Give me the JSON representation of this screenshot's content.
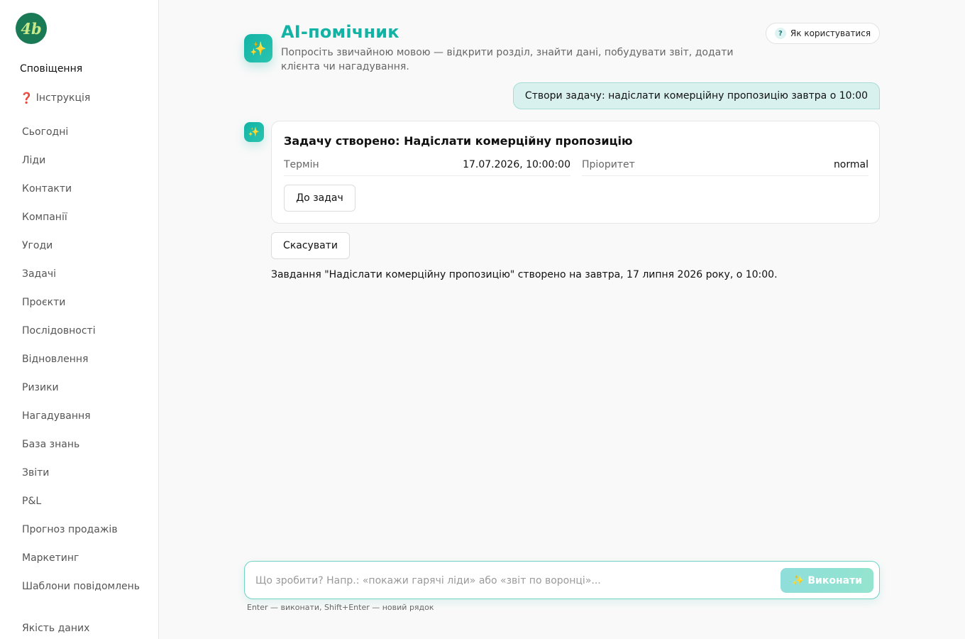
{
  "sidebar": {
    "logo_text": "4b",
    "notifications": "Сповіщення",
    "help_icon": "❓",
    "help_label": "Інструкція",
    "items": [
      {
        "label": "Сьогодні"
      },
      {
        "label": "Ліди"
      },
      {
        "label": "Контакти"
      },
      {
        "label": "Компанії"
      },
      {
        "label": "Угоди"
      },
      {
        "label": "Задачі"
      },
      {
        "label": "Проєкти"
      },
      {
        "label": "Послідовності"
      },
      {
        "label": "Відновлення"
      },
      {
        "label": "Ризики"
      },
      {
        "label": "Нагадування"
      },
      {
        "label": "База знань"
      },
      {
        "label": "Звіти"
      },
      {
        "label": "P&L"
      },
      {
        "label": "Прогноз продажів"
      },
      {
        "label": "Маркетинг"
      },
      {
        "label": "Шаблони повідомлень"
      },
      {
        "label": "Якість даних"
      }
    ]
  },
  "header": {
    "icon": "✨",
    "title": "AI-помічник",
    "subtitle": "Попросіть звичайною мовою — відкрити розділ, знайти дані, побудувати звіт, додати клієнта чи нагадування.",
    "help_button_icon": "?",
    "help_button_label": "Як користуватися"
  },
  "chat": {
    "user_message": "Створи задачу: надіслати комерційну пропозицію завтра о 10:00",
    "bot_icon": "✨",
    "card": {
      "title": "Задачу створено: Надіслати комерційну пропозицію",
      "fields": [
        {
          "label": "Термін",
          "value": "17.07.2026, 10:00:00"
        },
        {
          "label": "Пріоритет",
          "value": "normal"
        }
      ],
      "tasks_button": "До задач"
    },
    "cancel_button": "Скасувати",
    "result_text": "Завдання \"Надіслати комерційну пропозицію\" створено на завтра, 17 липня 2026 року, о 10:00."
  },
  "composer": {
    "placeholder": "Що зробити? Напр.: «покажи гарячі ліди» або «звіт по воронці»...",
    "value": "",
    "run_icon": "✨",
    "run_label": "Виконати",
    "hint": "Enter — виконати, Shift+Enter — новий рядок"
  },
  "colors": {
    "accent": "#12b3a5",
    "logo_bg": "#1a7a55",
    "user_bubble": "#d8f1ee"
  }
}
